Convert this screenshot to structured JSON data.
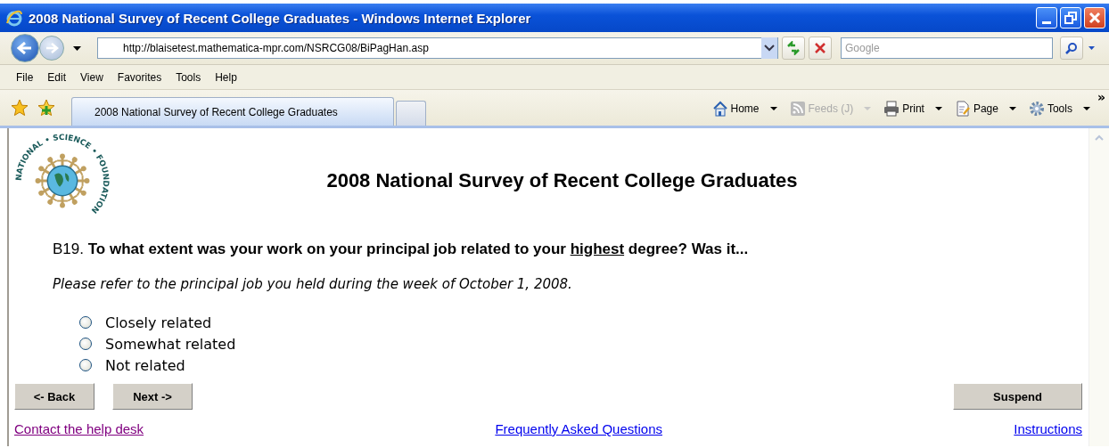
{
  "window": {
    "title": "2008 National Survey of Recent College Graduates - Windows Internet Explorer"
  },
  "address_bar": {
    "url": "http://blaisetest.mathematica-mpr.com/NSRCG08/BiPagHan.asp"
  },
  "search": {
    "placeholder": "Google"
  },
  "menu": [
    "File",
    "Edit",
    "View",
    "Favorites",
    "Tools",
    "Help"
  ],
  "tabs": [
    {
      "label": "2008 National Survey of Recent College Graduates",
      "selected": true
    }
  ],
  "command_bar": [
    {
      "label": "Home",
      "disabled": false,
      "kind": "home"
    },
    {
      "label": "Feeds (J)",
      "disabled": true,
      "kind": "feed"
    },
    {
      "label": "Print",
      "disabled": false,
      "kind": "print"
    },
    {
      "label": "Page",
      "disabled": false,
      "kind": "page"
    },
    {
      "label": "Tools",
      "disabled": false,
      "kind": "tools"
    }
  ],
  "overflow_chevron": "»",
  "page": {
    "logo_text": "NATIONAL • SCIENCE • FOUNDATION",
    "heading": "2008 National Survey of Recent College Graduates",
    "question": {
      "number": "B19.",
      "segments": [
        {
          "text": "To what extent was your work on your principal job related to your ",
          "underline": false
        },
        {
          "text": "highest",
          "underline": true
        },
        {
          "text": " degree? Was it...",
          "underline": false
        }
      ]
    },
    "instruction": "Please refer to the principal job you held during the week of October 1, 2008.",
    "options": [
      {
        "label": "Closely related",
        "selected": false
      },
      {
        "label": "Somewhat related",
        "selected": false
      },
      {
        "label": "Not related",
        "selected": false
      }
    ],
    "nav_buttons": [
      "<- Back",
      "Next ->"
    ],
    "suspend_button": "Suspend",
    "links": [
      {
        "label": "Contact the help desk",
        "visited": true
      },
      {
        "label": "Frequently Asked Questions",
        "visited": false
      },
      {
        "label": "Instructions",
        "visited": false
      }
    ]
  }
}
